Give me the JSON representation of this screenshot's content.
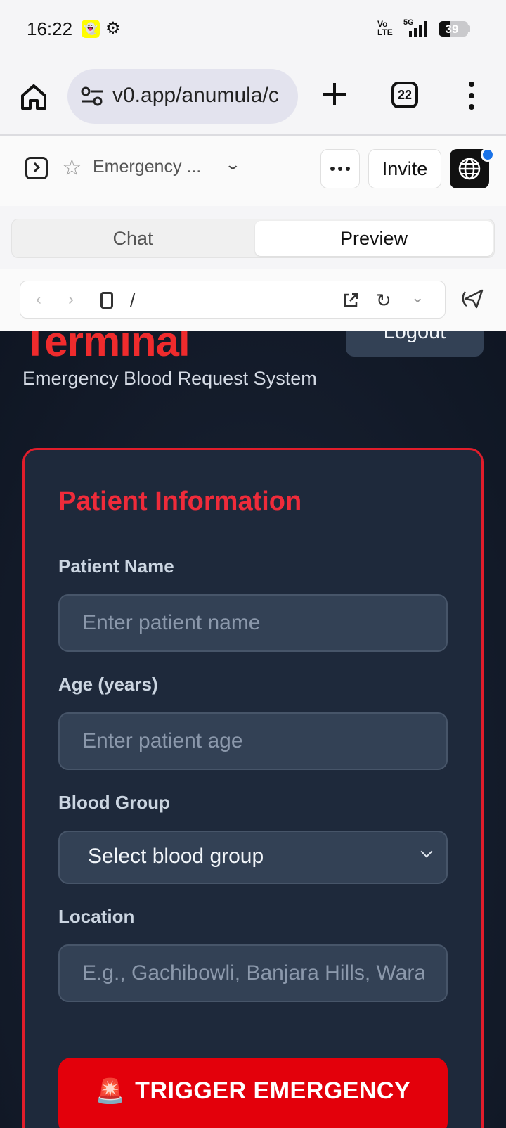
{
  "status_bar": {
    "time": "16:22",
    "network_label": "Vo LTE",
    "network_type": "5G",
    "battery_level": "39"
  },
  "browser": {
    "url": "v0.app/anumula/c",
    "tab_count": "22"
  },
  "v0_header": {
    "project_name": "Emergency ...",
    "invite_label": "Invite",
    "notification_color": "#1a73e8"
  },
  "view_toggle": {
    "chat_label": "Chat",
    "preview_label": "Preview",
    "selected": "Preview"
  },
  "preview_toolbar": {
    "path": "/"
  },
  "app": {
    "title": "Terminal",
    "logout_label": "Logout",
    "subtitle": "Emergency Blood Request System",
    "accent_color": "#ef2b2d",
    "form": {
      "title": "Patient Information",
      "patient_name_label": "Patient Name",
      "patient_name_placeholder": "Enter patient name",
      "age_label": "Age (years)",
      "age_placeholder": "Enter patient age",
      "blood_group_label": "Blood Group",
      "blood_group_value": "Select blood group",
      "location_label": "Location",
      "location_placeholder": "E.g., Gachibowli, Banjara Hills, Warangal",
      "trigger_icon": "🚨",
      "trigger_label": "TRIGGER EMERGENCY"
    }
  }
}
